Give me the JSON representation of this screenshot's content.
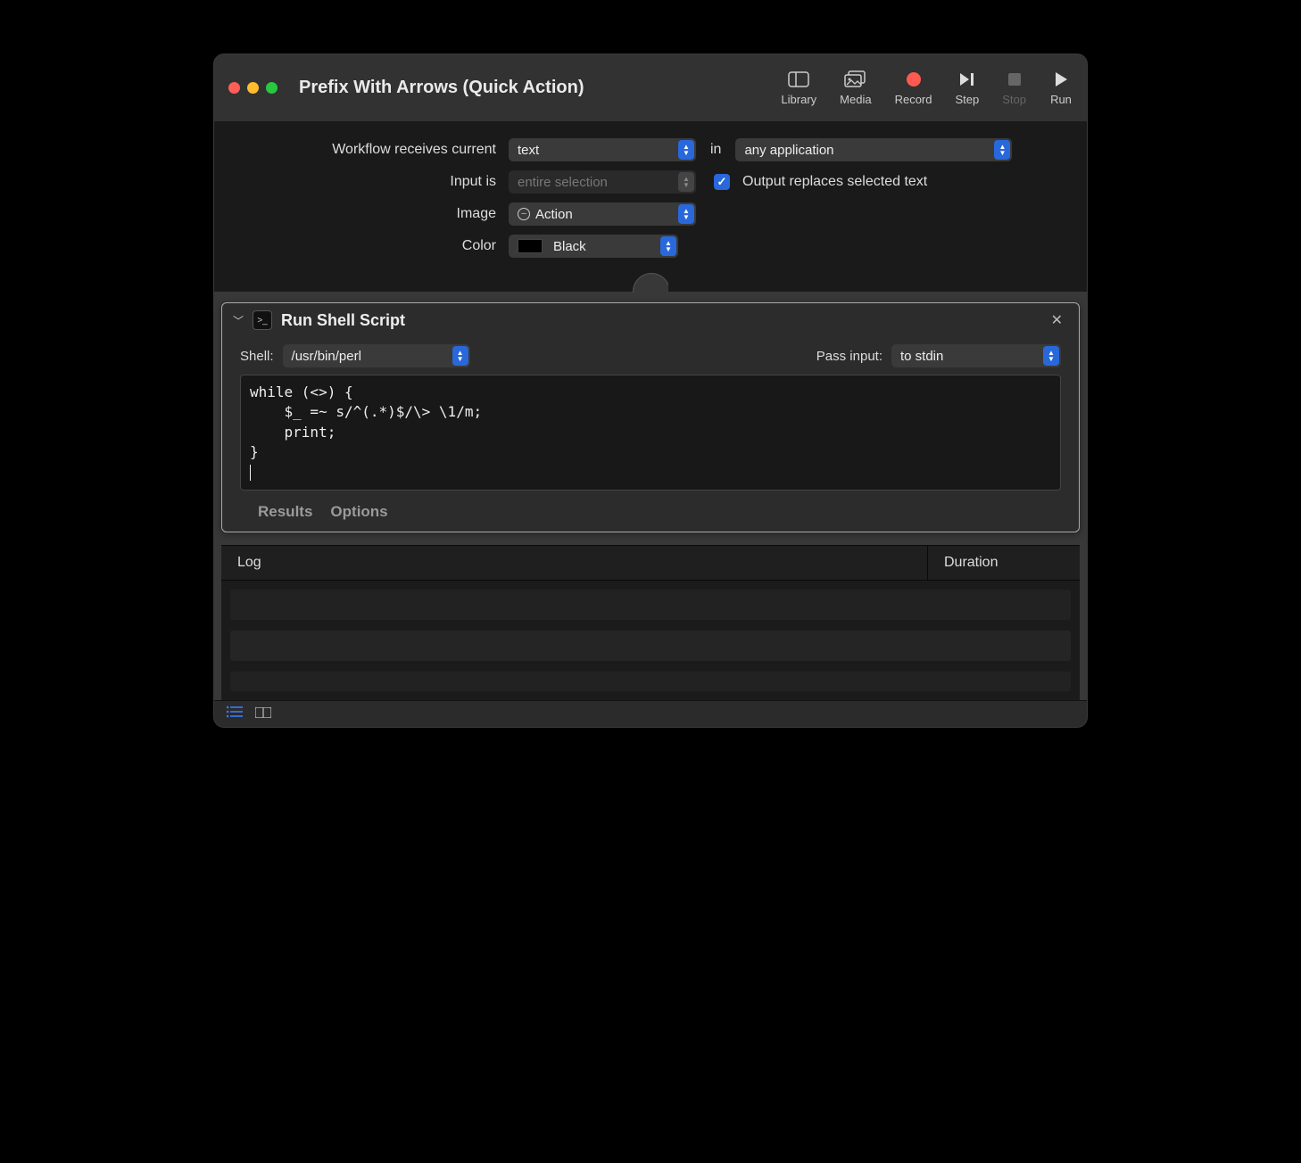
{
  "header": {
    "title": "Prefix With Arrows (Quick Action)",
    "toolbar": {
      "library": "Library",
      "media": "Media",
      "record": "Record",
      "step": "Step",
      "stop": "Stop",
      "run": "Run"
    }
  },
  "config": {
    "receives_label": "Workflow receives current",
    "receives_value": "text",
    "in_label": "in",
    "in_value": "any application",
    "input_label": "Input is",
    "input_value": "entire selection",
    "output_checkbox_label": "Output replaces selected text",
    "output_checked": true,
    "image_label": "Image",
    "image_value": "Action",
    "color_label": "Color",
    "color_value": "Black"
  },
  "action": {
    "title": "Run Shell Script",
    "shell_label": "Shell:",
    "shell_value": "/usr/bin/perl",
    "pass_input_label": "Pass input:",
    "pass_input_value": "to stdin",
    "script": "while (<>) {\n    $_ =~ s/^(.*)$/\\> \\1/m;\n    print;\n}\n",
    "footer": {
      "results": "Results",
      "options": "Options"
    }
  },
  "log": {
    "col_log": "Log",
    "col_duration": "Duration"
  }
}
